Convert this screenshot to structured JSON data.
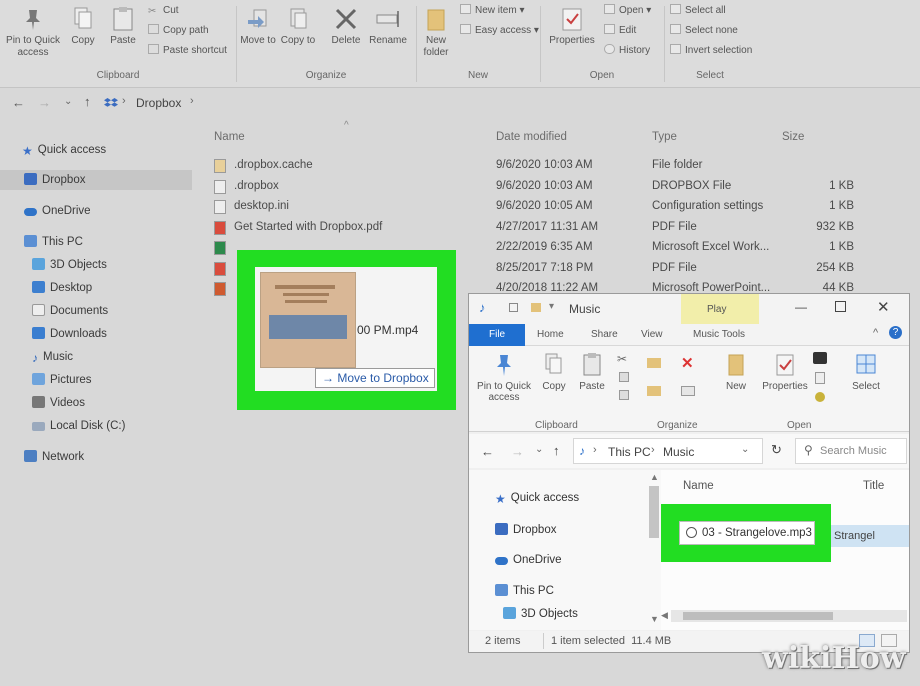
{
  "ribbon": {
    "clipboard": {
      "pin": "Pin to Quick access",
      "copy": "Copy",
      "paste": "Paste",
      "cut": "Cut",
      "copy_path": "Copy path",
      "paste_shortcut": "Paste shortcut",
      "group": "Clipboard"
    },
    "organize": {
      "move_to": "Move to",
      "copy_to": "Copy to",
      "delete": "Delete",
      "rename": "Rename",
      "group": "Organize"
    },
    "new": {
      "new_folder": "New folder",
      "new_item": "New item",
      "easy_access": "Easy access",
      "group": "New"
    },
    "open": {
      "properties": "Properties",
      "open": "Open",
      "edit": "Edit",
      "history": "History",
      "group": "Open"
    },
    "select": {
      "select_all": "Select all",
      "select_none": "Select none",
      "invert_selection": "Invert selection",
      "group": "Select"
    }
  },
  "address": {
    "location": "Dropbox"
  },
  "nav": {
    "quick_access": "Quick access",
    "dropbox": "Dropbox",
    "onedrive": "OneDrive",
    "this_pc": "This PC",
    "objects_3d": "3D Objects",
    "desktop": "Desktop",
    "documents": "Documents",
    "downloads": "Downloads",
    "music": "Music",
    "pictures": "Pictures",
    "videos": "Videos",
    "local_disk": "Local Disk (C:)",
    "network": "Network"
  },
  "columns": {
    "name": "Name",
    "date": "Date modified",
    "type": "Type",
    "size": "Size"
  },
  "files": [
    {
      "name": ".dropbox.cache",
      "date": "9/6/2020 10:03 AM",
      "type": "File folder",
      "size": ""
    },
    {
      "name": ".dropbox",
      "date": "9/6/2020 10:03 AM",
      "type": "DROPBOX File",
      "size": "1 KB"
    },
    {
      "name": "desktop.ini",
      "date": "9/6/2020 10:05 AM",
      "type": "Configuration settings",
      "size": "1 KB"
    },
    {
      "name": "Get Started with Dropbox.pdf",
      "date": "4/27/2017 11:31 AM",
      "type": "PDF File",
      "size": "932 KB"
    },
    {
      "name": "",
      "date": "2/22/2019 6:35 AM",
      "type": "Microsoft Excel Work...",
      "size": "1 KB"
    },
    {
      "name": "",
      "date": "8/25/2017 7:18 PM",
      "type": "PDF File",
      "size": "254 KB"
    },
    {
      "name": "",
      "date": "4/20/2018 11:22 AM",
      "type": "Microsoft PowerPoint...",
      "size": "44 KB"
    }
  ],
  "drag": {
    "file_name": "00 PM.mp4",
    "move_to": "→ Move to Dropbox"
  },
  "music_window": {
    "title": "Music",
    "context_tab": "Play",
    "tabs": {
      "file": "File",
      "home": "Home",
      "share": "Share",
      "view": "View",
      "music_tools": "Music Tools"
    },
    "ribbon": {
      "pin": "Pin to Quick access",
      "copy": "Copy",
      "paste": "Paste",
      "new": "New",
      "properties": "Properties",
      "select": "Select",
      "group_clipboard": "Clipboard",
      "group_organize": "Organize",
      "group_open": "Open"
    },
    "path": {
      "this_pc": "This PC",
      "music": "Music"
    },
    "search_placeholder": "Search Music",
    "columns": {
      "name": "Name",
      "title": "Title"
    },
    "nav": {
      "quick_access": "Quick access",
      "dropbox": "Dropbox",
      "onedrive": "OneDrive",
      "this_pc": "This PC",
      "objects_3d": "3D Objects"
    },
    "file": "03 - Strangelove.mp3",
    "file_title": "Strangel",
    "status": {
      "items": "2 items",
      "selected": "1 item selected  11.4 MB"
    }
  },
  "watermark": "wikiHow",
  "colors": {
    "highlight": "#22dd22",
    "accent": "#2a6fc9"
  }
}
